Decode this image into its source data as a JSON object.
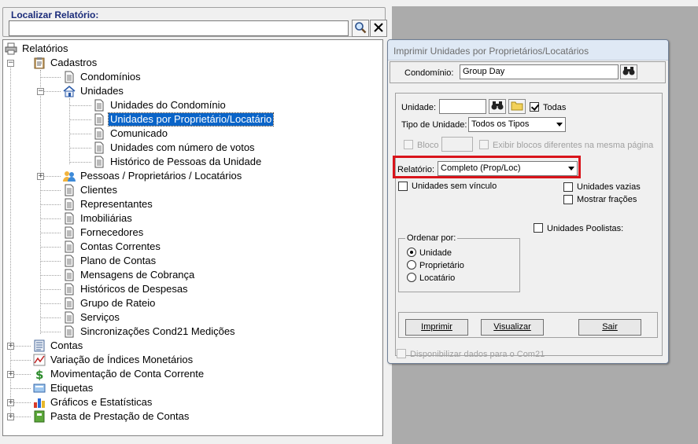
{
  "search": {
    "legend": "Localizar Relatório:",
    "value": ""
  },
  "tree": {
    "root": "Relatórios",
    "cadastros": "Cadastros",
    "condominios": "Condomínios",
    "unidades": "Unidades",
    "unidades_children": [
      "Unidades do Condomínio",
      "Unidades por Proprietário/Locatário",
      "Comunicado",
      "Unidades com número de votos",
      "Histórico de Pessoas da Unidade"
    ],
    "cadastros_after": [
      "Pessoas / Proprietários / Locatários",
      "Clientes",
      "Representantes",
      "Imobiliárias",
      "Fornecedores",
      "Contas Correntes",
      "Plano de Contas",
      "Mensagens de Cobrança",
      "Históricos de Despesas",
      "Grupo de Rateio",
      "Serviços",
      "Sincronizações Cond21 Medições"
    ],
    "top_level": [
      "Contas",
      "Variação de Índices Monetários",
      "Movimentação de Conta Corrente",
      "Etiquetas",
      "Gráficos e Estatísticas",
      "Pasta de Prestação de Contas"
    ]
  },
  "dialog": {
    "title": "Imprimir Unidades por Proprietários/Locatários",
    "condominio_label": "Condomínio:",
    "condominio_value": "Group Day",
    "unidade_label": "Unidade:",
    "unidade_value": "",
    "todas_label": "Todas",
    "tipo_unidade_label": "Tipo de Unidade:",
    "tipo_unidade_value": "Todos os Tipos",
    "bloco_label": "Bloco",
    "bloco_value": "",
    "exibir_blocos_label": "Exibir blocos diferentes na mesma página",
    "relatorio_label": "Relatório:",
    "relatorio_value": "Completo (Prop/Loc)",
    "sem_vinculo_label": "Unidades sem vínculo",
    "vazias_label": "Unidades vazias",
    "mostrar_fracoes_label": "Mostrar frações",
    "poolistas_label": "Unidades Poolistas:",
    "ordenar_label": "Ordenar por:",
    "ordenar_options": [
      "Unidade",
      "Proprietário",
      "Locatário"
    ],
    "ordenar_selected": "Unidade",
    "imprimir_label": "Imprimir",
    "visualizar_label": "Visualizar",
    "sair_label": "Sair",
    "com21_label": "Disponibilizar dados para o Com21"
  },
  "colors": {
    "selection": "#0a64c8",
    "highlight_border": "#d9141b",
    "legend": "#1b2c7a"
  }
}
